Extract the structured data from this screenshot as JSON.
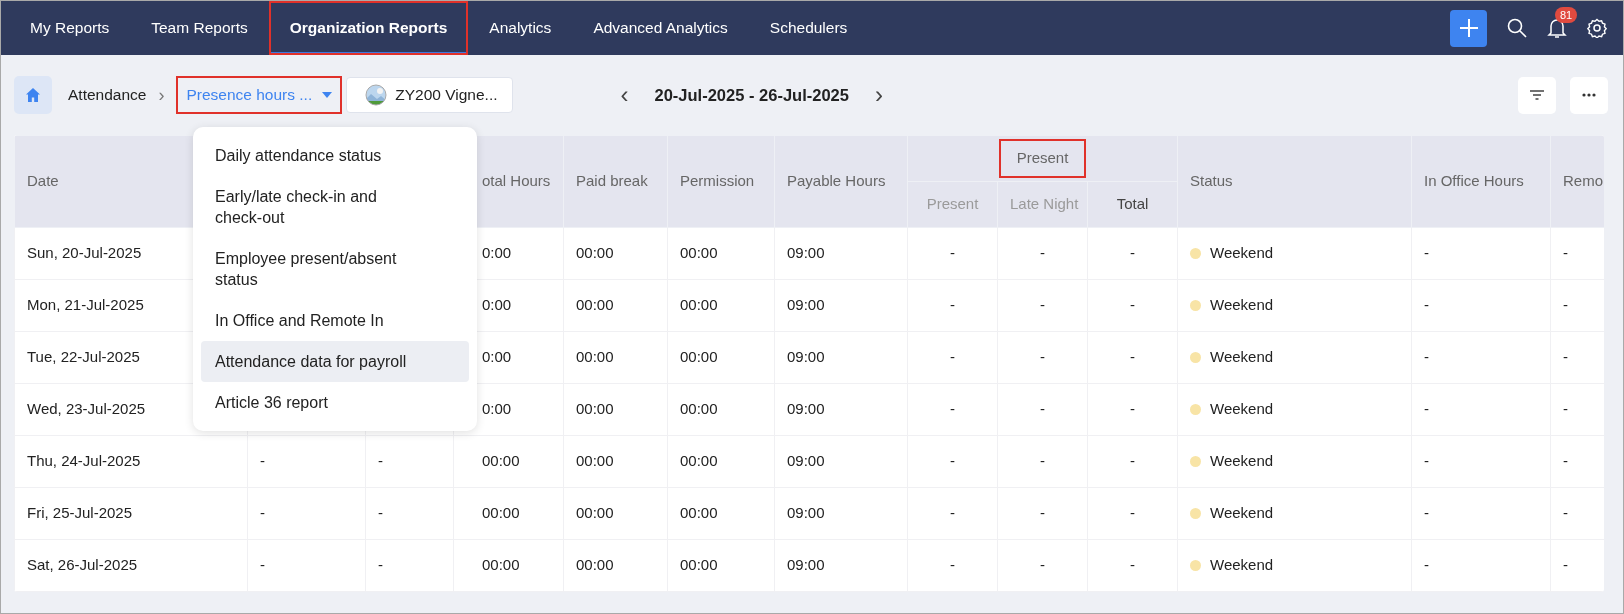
{
  "nav": {
    "tabs": [
      {
        "label": "My Reports",
        "selected": false,
        "highlighted": false
      },
      {
        "label": "Team Reports",
        "selected": false,
        "highlighted": false
      },
      {
        "label": "Organization Reports",
        "selected": true,
        "highlighted": true
      },
      {
        "label": "Analytics",
        "selected": false,
        "highlighted": false
      },
      {
        "label": "Advanced Analytics",
        "selected": false,
        "highlighted": false
      },
      {
        "label": "Schedulers",
        "selected": false,
        "highlighted": false
      }
    ],
    "notification_count": "81"
  },
  "toolbar": {
    "breadcrumb": "Attendance",
    "separator": "›",
    "report_dropdown": {
      "value": "Presence hours ...",
      "highlighted": true
    },
    "employee": "ZY200 Vigne...",
    "prev": "‹",
    "date_range": "20-Jul-2025 - 26-Jul-2025",
    "next": "›"
  },
  "report_menu": [
    {
      "label": "Daily attendance status",
      "selected": false
    },
    {
      "label": "Early/late check-in and check-out",
      "selected": false
    },
    {
      "label": "Employee present/absent status",
      "selected": false
    },
    {
      "label": "In Office and Remote In",
      "selected": false
    },
    {
      "label": "Attendance data for payroll",
      "selected": true
    },
    {
      "label": "Article 36 report",
      "selected": false
    }
  ],
  "table": {
    "column_groups": [
      {
        "label": "Present",
        "highlighted": true
      }
    ],
    "columns": [
      {
        "kind": "single",
        "label": "Date"
      },
      {
        "kind": "covered"
      },
      {
        "kind": "covered"
      },
      {
        "kind": "single",
        "label": "otal Hours"
      },
      {
        "kind": "single",
        "label": "Paid break"
      },
      {
        "kind": "single",
        "label": "Permission"
      },
      {
        "kind": "single",
        "label": "Payable Hours"
      },
      {
        "kind": "grouped",
        "label": "Present",
        "muted": true
      },
      {
        "kind": "grouped",
        "label": "Late Night",
        "muted": true
      },
      {
        "kind": "grouped",
        "label": "Total",
        "muted": false
      },
      {
        "kind": "single",
        "label": "Status"
      },
      {
        "kind": "single",
        "label": "In Office Hours"
      },
      {
        "kind": "single",
        "label": "Remo"
      }
    ],
    "rows": [
      {
        "cells": [
          "Sun, 20-Jul-2025",
          null,
          null,
          "0:00",
          "00:00",
          "00:00",
          "09:00",
          "-",
          "-",
          "-",
          {
            "label": "Weekend",
            "color": "#f8e4a6"
          },
          "-",
          "-"
        ]
      },
      {
        "cells": [
          "Mon, 21-Jul-2025",
          null,
          null,
          "0:00",
          "00:00",
          "00:00",
          "09:00",
          "-",
          "-",
          "-",
          {
            "label": "Weekend",
            "color": "#f8e4a6"
          },
          "-",
          "-"
        ]
      },
      {
        "cells": [
          "Tue, 22-Jul-2025",
          null,
          null,
          "0:00",
          "00:00",
          "00:00",
          "09:00",
          "-",
          "-",
          "-",
          {
            "label": "Weekend",
            "color": "#f8e4a6"
          },
          "-",
          "-"
        ]
      },
      {
        "cells": [
          "Wed, 23-Jul-2025",
          null,
          null,
          "0:00",
          "00:00",
          "00:00",
          "09:00",
          "-",
          "-",
          "-",
          {
            "label": "Weekend",
            "color": "#f8e4a6"
          },
          "-",
          "-"
        ]
      },
      {
        "cells": [
          "Thu, 24-Jul-2025",
          "-",
          "-",
          "00:00",
          "00:00",
          "00:00",
          "09:00",
          "-",
          "-",
          "-",
          {
            "label": "Weekend",
            "color": "#f8e4a6"
          },
          "-",
          "-"
        ]
      },
      {
        "cells": [
          "Fri, 25-Jul-2025",
          "-",
          "-",
          "00:00",
          "00:00",
          "00:00",
          "09:00",
          "-",
          "-",
          "-",
          {
            "label": "Weekend",
            "color": "#f8e4a6"
          },
          "-",
          "-"
        ]
      },
      {
        "cells": [
          "Sat, 26-Jul-2025",
          "-",
          "-",
          "00:00",
          "00:00",
          "00:00",
          "09:00",
          "-",
          "-",
          "-",
          {
            "label": "Weekend",
            "color": "#f8e4a6"
          },
          "-",
          "-"
        ]
      }
    ]
  }
}
